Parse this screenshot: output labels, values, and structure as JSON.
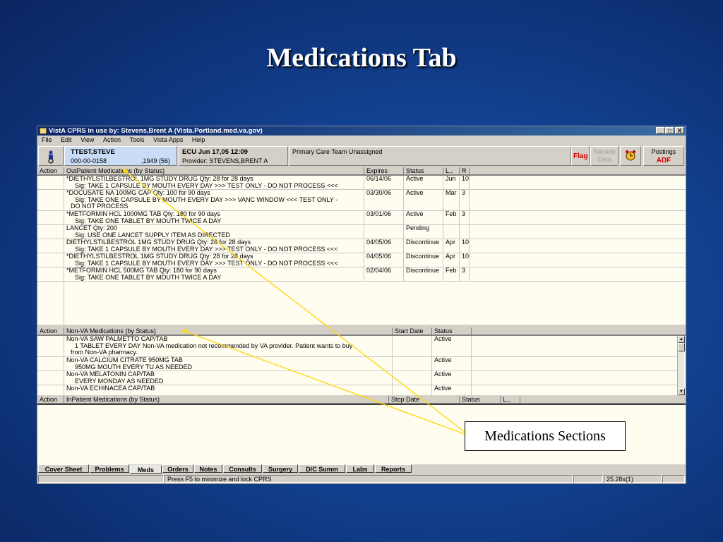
{
  "slide_title": "Medications Tab",
  "window": {
    "title": "VistA CPRS in use by: Stevens,Brent A  (Vista.Portland.med.va.gov)",
    "controls": [
      "_",
      "□",
      "X"
    ]
  },
  "menu": [
    "File",
    "Edit",
    "View",
    "Action",
    "Tools",
    "Vista Apps",
    "Help"
  ],
  "patient": {
    "name": "TTEST,STEVE",
    "ssn": "000-00-0158",
    "dob": ",1949 (56)"
  },
  "encounter": {
    "location": "ECU Jun 17,05 12:09",
    "provider": "Provider:  STEVENS,BRENT A"
  },
  "team": "Primary Care Team Unassigned",
  "flag_label": "Flag",
  "remote_data": "Remote Data",
  "postings": {
    "label": "Postings",
    "value": "ADF"
  },
  "outpatient": {
    "headers": [
      "Action",
      "OutPatient Medications (by Status)",
      "Expires",
      "Status",
      "L..",
      "R"
    ],
    "rows": [
      {
        "name": "*DIETHYLSTILBESTROL 1MG STUDY DRUG  Qty: 28 for 28 days",
        "sig": "Sig: TAKE 1 CAPSULE BY MOUTH EVERY DAY >>> TEST ONLY - DO NOT PROCESS <<<",
        "sig2": "",
        "expires": "06/14/06",
        "status": "Active",
        "last": "Jun",
        "refills": "10"
      },
      {
        "name": "*DOCUSATE NA 100MG CAP  Qty: 100 for 90 days",
        "sig": "Sig: TAKE ONE CAPSULE BY MOUTH EVERY DAY >>> VANC WINDOW <<< TEST ONLY -",
        "sig2": "DO  NOT PROCESS",
        "expires": "03/30/06",
        "status": "Active",
        "last": "Mar",
        "refills": "3"
      },
      {
        "name": "*METFORMIN HCL 1000MG TAB  Qty: 180 for 90 days",
        "sig": "Sig: TAKE ONE TABLET BY MOUTH TWICE A DAY",
        "sig2": "",
        "expires": "03/01/06",
        "status": "Active",
        "last": "Feb",
        "refills": "3"
      },
      {
        "name": "LANCET  Qty: 200",
        "sig": "Sig: USE ONE LANCET SUPPLY ITEM AS DIRECTED",
        "sig2": "",
        "expires": "",
        "status": "Pending",
        "last": "",
        "refills": ""
      },
      {
        "name": "DIETHYLSTILBESTROL 1MG STUDY DRUG  Qty: 28 for 28 days",
        "sig": "Sig: TAKE 1 CAPSULE BY MOUTH EVERY DAY >>> TEST ONLY - DO NOT PROCESS <<<",
        "sig2": "",
        "expires": "04/05/06",
        "status": "Discontinue",
        "last": "Apr",
        "refills": "10"
      },
      {
        "name": "*DIETHYLSTILBESTROL 1MG STUDY DRUG  Qty: 28 for 28 days",
        "sig": "Sig: TAKE 1 CAPSULE BY MOUTH EVERY DAY >>> TEST ONLY - DO NOT PROCESS <<<",
        "sig2": "",
        "expires": "04/05/06",
        "status": "Discontinue",
        "last": "Apr",
        "refills": "10"
      },
      {
        "name": "*METFORMIN HCL 500MG TAB  Qty: 180 for 90 days",
        "sig": "Sig: TAKE ONE TABLET BY MOUTH TWICE A DAY",
        "sig2": "",
        "expires": "02/04/06",
        "status": "Discontinue",
        "last": "Feb",
        "refills": "3"
      }
    ]
  },
  "nonva": {
    "headers": [
      "Action",
      "Non-VA Medications (by Status)",
      "Start Date",
      "Status"
    ],
    "rows": [
      {
        "name": "Non-VA  SAW PALMETTO CAP/TAB",
        "sig": "1 TABLET  EVERY DAY  Non-VA medication not recommended by VA provider.   Patient wants to buy",
        "sig2": "from Non-VA pharmacy.",
        "start": "",
        "status": "Active"
      },
      {
        "name": "Non-VA  CALCIUM CITRATE 950MG TAB",
        "sig": "950MG MOUTH EVERY TU AS NEEDED",
        "sig2": "",
        "start": "",
        "status": "Active"
      },
      {
        "name": "Non-VA  MELATONIN CAP/TAB",
        "sig": "EVERY MONDAY AS NEEDED",
        "sig2": "",
        "start": "",
        "status": "Active"
      },
      {
        "name": "Non-VA  ECHINACEA CAP/TAB",
        "sig": "",
        "sig2": "",
        "start": "",
        "status": "Active"
      }
    ]
  },
  "inpatient": {
    "headers": [
      "Action",
      "InPatient Medications (by Status)",
      "Stop Date",
      "Status",
      "L..."
    ]
  },
  "tabs": [
    "Cover Sheet",
    "Problems",
    "Meds",
    "Orders",
    "Notes",
    "Consults",
    "Surgery",
    "D/C Summ",
    "Labs",
    "Reports"
  ],
  "active_tab": "Meds",
  "status_bar": {
    "message": "Press F5 to minimize and lock CPRS",
    "coords": "25.28x(1)"
  },
  "callout": "Medications Sections",
  "colors": {
    "background": "#12408f",
    "title_bar": "#0a246a",
    "patient_box": "#c9dcf5",
    "flag": "#d00000",
    "grid": "#fffcf0",
    "callout_lines": "#ffd700"
  }
}
